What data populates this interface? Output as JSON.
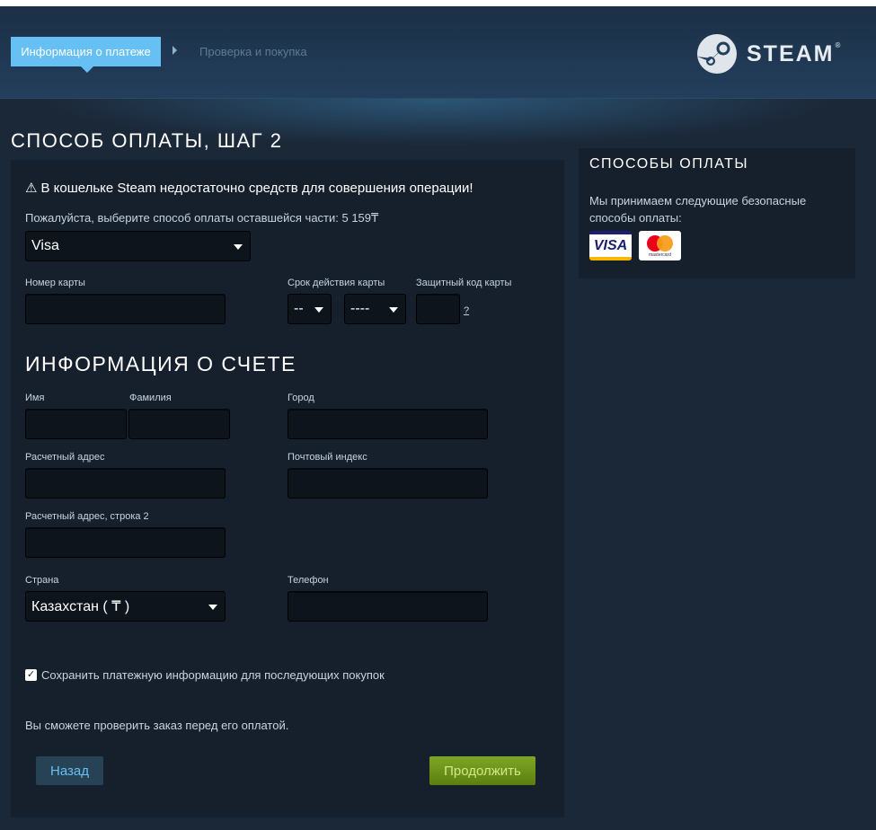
{
  "header": {
    "steps": [
      {
        "label": "Информация о платеже",
        "active": true
      },
      {
        "label": "Проверка и покупка",
        "active": false
      }
    ],
    "logo_text": "STEAM",
    "logo_reg": "®",
    "logo_icon": "steam-logo-icon"
  },
  "page": {
    "title": "СПОСОБ ОПЛАТЫ, ШАГ 2"
  },
  "payment": {
    "warning_icon": "⚠",
    "warning": "В кошельке Steam недостаточно средств для совершения операции!",
    "choose_text": "Пожалуйста, выберите способ оплаты оставшейся части: 5 159₸",
    "method_selected": "Visa",
    "card_number_label": "Номер карты",
    "card_number_value": "",
    "expiry_label": "Срок действия карты",
    "expiry_month": "--",
    "expiry_year": "----",
    "cvv_label": "Защитный код карты",
    "cvv_value": "",
    "cvv_help": "?"
  },
  "billing": {
    "title": "ИНФОРМАЦИЯ О СЧЕТЕ",
    "first_name_label": "Имя",
    "last_name_label": "Фамилия",
    "city_label": "Город",
    "address_label": "Расчетный адрес",
    "postal_label": "Почтовый индекс",
    "address2_label": "Расчетный адрес, строка 2",
    "country_label": "Страна",
    "country_selected": "Казахстан ( ₸ )",
    "phone_label": "Телефон"
  },
  "footer": {
    "save_checked": true,
    "save_checkmark": "✓",
    "save_label": "Сохранить платежную информацию для последующих покупок",
    "review_text": "Вы сможете проверить заказ перед его оплатой.",
    "back_label": "Назад",
    "continue_label": "Продолжить"
  },
  "sidebar": {
    "title": "СПОСОБЫ ОПЛАТЫ",
    "text": "Мы принимаем следующие безопасные способы оплаты:",
    "cards": [
      {
        "name": "visa",
        "label": "VISA"
      },
      {
        "name": "mastercard",
        "label": "mastercard"
      }
    ]
  },
  "colors": {
    "accent": "#66c0f4",
    "background": "#1b2838",
    "panel": "#16202d",
    "continue_button": "#6c9318"
  }
}
